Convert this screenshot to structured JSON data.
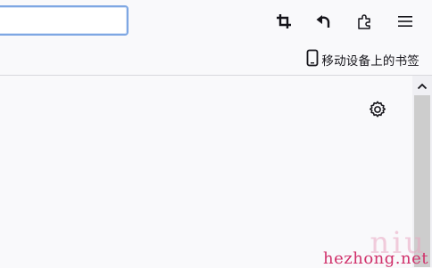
{
  "toolbar": {
    "url_value": "",
    "buttons": [
      {
        "icon": "crop-icon"
      },
      {
        "icon": "undo-arrow-icon"
      },
      {
        "icon": "extensions-puzzle-icon"
      },
      {
        "icon": "hamburger-menu-icon"
      }
    ]
  },
  "bookmarks": {
    "mobile_label": "移动设备上的书签",
    "mobile_icon": "mobile-device-icon"
  },
  "content": {
    "settings_icon": "gear-icon"
  },
  "watermark": {
    "site": "hezhong.net",
    "brand": "niu"
  },
  "colors": {
    "focus_ring": "#7ea7e3",
    "background": "#f9f9fb",
    "watermark": "#d0306a"
  }
}
